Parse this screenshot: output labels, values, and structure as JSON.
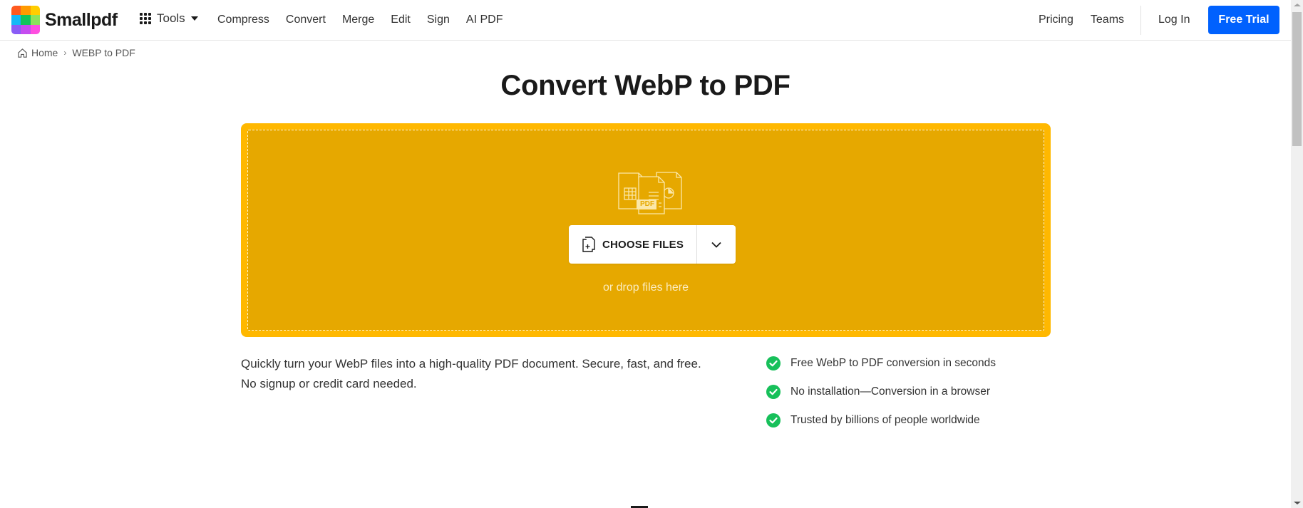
{
  "header": {
    "brand": "Smallpdf",
    "logo_colors": [
      "#ff5a1f",
      "#ff9a00",
      "#ffcd00",
      "#15b8f6",
      "#12c45c",
      "#8de35a",
      "#8a5cf6",
      "#c54df0",
      "#ff4fe0"
    ],
    "tools_label": "Tools",
    "nav_left": [
      "Compress",
      "Convert",
      "Merge",
      "Edit",
      "Sign",
      "AI PDF"
    ],
    "nav_right": [
      "Pricing",
      "Teams"
    ],
    "login_label": "Log In",
    "cta_label": "Free Trial",
    "cta_color": "#0061fe"
  },
  "breadcrumb": {
    "home": "Home",
    "separator": "›",
    "current": "WEBP to PDF"
  },
  "main": {
    "title": "Convert WebP to PDF",
    "dropzone": {
      "outer_color": "#ffb800",
      "inner_color": "#e6a800",
      "choose_label": "CHOOSE FILES",
      "drop_hint": "or drop files here",
      "doc_badge": "PDF"
    },
    "description": [
      "Quickly turn your WebP files into a high-quality PDF document. Secure, fast, and free.",
      "No signup or credit card needed."
    ],
    "features": [
      "Free WebP to PDF conversion in seconds",
      "No installation—Conversion in a browser",
      "Trusted by billions of people worldwide"
    ],
    "check_color": "#17c05a"
  }
}
